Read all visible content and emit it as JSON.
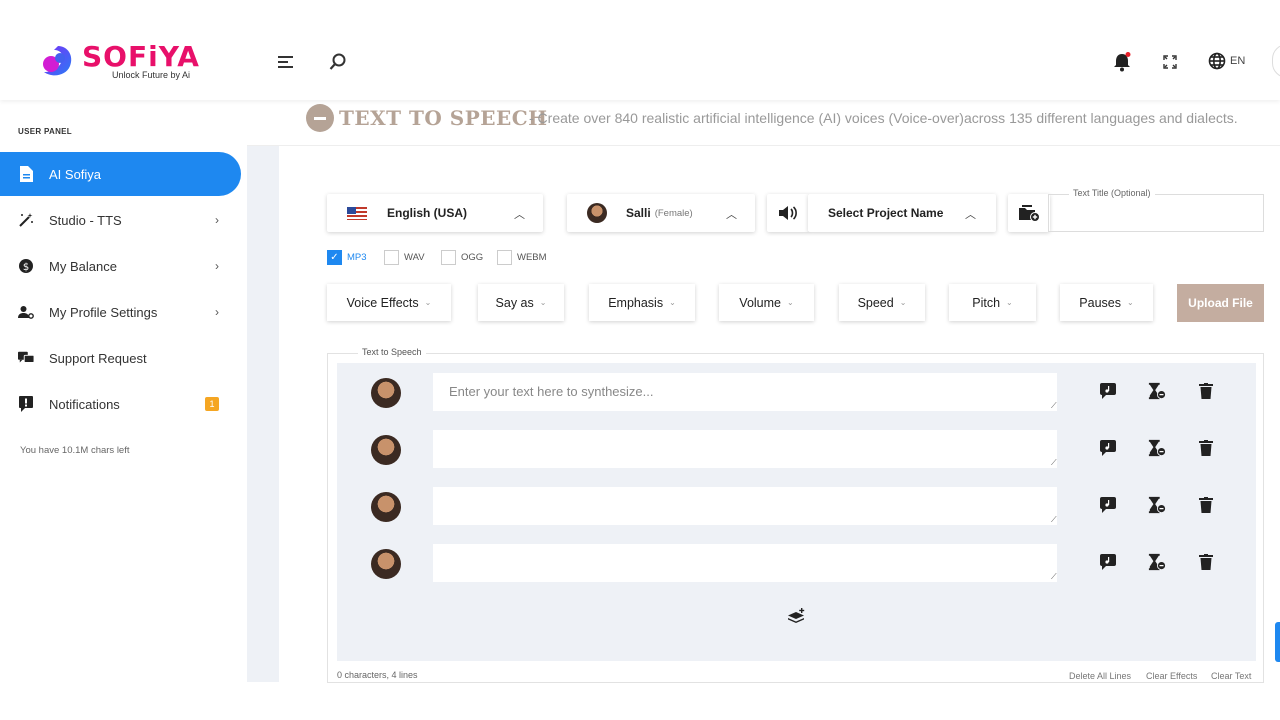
{
  "brand": {
    "name": "SOFiYA",
    "tagline": "Unlock Future by Ai"
  },
  "topbar": {
    "language": "EN"
  },
  "sidebar": {
    "panel_title": "USER PANEL",
    "items": [
      {
        "label": "AI Sofiya",
        "icon": "file-icon",
        "active": true
      },
      {
        "label": "Studio - TTS",
        "icon": "magic-wand-icon"
      },
      {
        "label": "My Balance",
        "icon": "dollar-coin-icon"
      },
      {
        "label": "My Profile Settings",
        "icon": "user-gear-icon"
      },
      {
        "label": "Support Request",
        "icon": "chat-bubbles-icon"
      },
      {
        "label": "Notifications",
        "icon": "alert-message-icon",
        "badge": "1"
      }
    ],
    "chars_left": "You have 10.1M chars left"
  },
  "header": {
    "title": "TEXT TO SPEECH",
    "description": "- Create over 840 realistic artificial intelligence (AI) voices (Voice-over)across 135 different languages and dialects."
  },
  "controls": {
    "language": "English (USA)",
    "voice_name": "Salli",
    "voice_gender": "(Female)",
    "project": "Select Project Name",
    "title_label": "Text Title (Optional)",
    "title_value": ""
  },
  "formats": [
    {
      "label": "MP3",
      "checked": true
    },
    {
      "label": "WAV",
      "checked": false
    },
    {
      "label": "OGG",
      "checked": false
    },
    {
      "label": "WEBM",
      "checked": false
    }
  ],
  "effects": [
    "Voice Effects",
    "Say as",
    "Emphasis",
    "Volume",
    "Speed",
    "Pitch",
    "Pauses"
  ],
  "upload_label": "Upload File",
  "tts": {
    "legend": "Text to Speech",
    "placeholder": "Enter your text here to synthesize...",
    "lines": [
      "",
      "",
      "",
      ""
    ],
    "footer_count": "0 characters, 4 lines",
    "delete_all": "Delete All Lines",
    "clear_effects": "Clear Effects",
    "clear_text": "Clear Text"
  },
  "colors": {
    "accent": "#1e88f0",
    "brand": "#e8106a",
    "muted_brown": "#b5a396",
    "badge": "#f5a623"
  }
}
